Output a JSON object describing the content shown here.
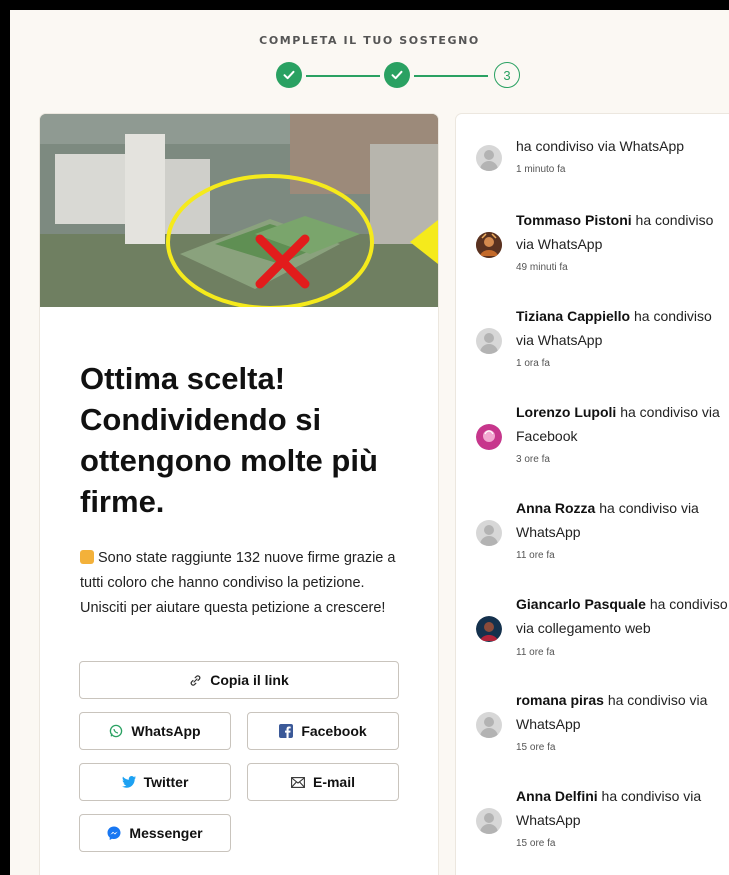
{
  "progress": {
    "title": "COMPLETA IL TUO SOSTEGNO",
    "step3_label": "3",
    "accent_color": "#2aa162"
  },
  "main": {
    "headline": "Ottima scelta! Condividendo si ottengono molte più firme.",
    "description": "Sono state raggiunte 132 nuove firme grazie a tutti coloro che hanno condiviso la petizione. Unisciti per aiutare questa petizione a crescere!",
    "description_icon": "clapping-hands-emoji",
    "buttons": {
      "copy_link": "Copia il link",
      "whatsapp": "WhatsApp",
      "facebook": "Facebook",
      "twitter": "Twitter",
      "email": "E-mail",
      "messenger": "Messenger"
    }
  },
  "feed": [
    {
      "name": "",
      "action": "ha condiviso via WhatsApp",
      "time": "1 minuto fa",
      "avatar": "default-avatar"
    },
    {
      "name": "Tommaso Pistoni",
      "action": " ha condiviso via WhatsApp",
      "time": "49 minuti fa",
      "avatar": "photo-avatar"
    },
    {
      "name": "Tiziana Cappiello",
      "action": " ha condiviso via WhatsApp",
      "time": "1 ora fa",
      "avatar": "default-avatar"
    },
    {
      "name": "Lorenzo Lupoli",
      "action": " ha condiviso via Facebook",
      "time": "3 ore fa",
      "avatar": "photo-avatar"
    },
    {
      "name": "Anna Rozza",
      "action": " ha condiviso via WhatsApp",
      "time": "11 ore fa",
      "avatar": "default-avatar"
    },
    {
      "name": "Giancarlo Pasquale",
      "action": " ha condiviso via collegamento web",
      "time": "11 ore fa",
      "avatar": "photo-avatar"
    },
    {
      "name": "romana piras",
      "action": " ha condiviso via WhatsApp",
      "time": "15 ore fa",
      "avatar": "default-avatar"
    },
    {
      "name": "Anna Delfini",
      "action": " ha condiviso via WhatsApp",
      "time": "15 ore fa",
      "avatar": "default-avatar"
    }
  ]
}
